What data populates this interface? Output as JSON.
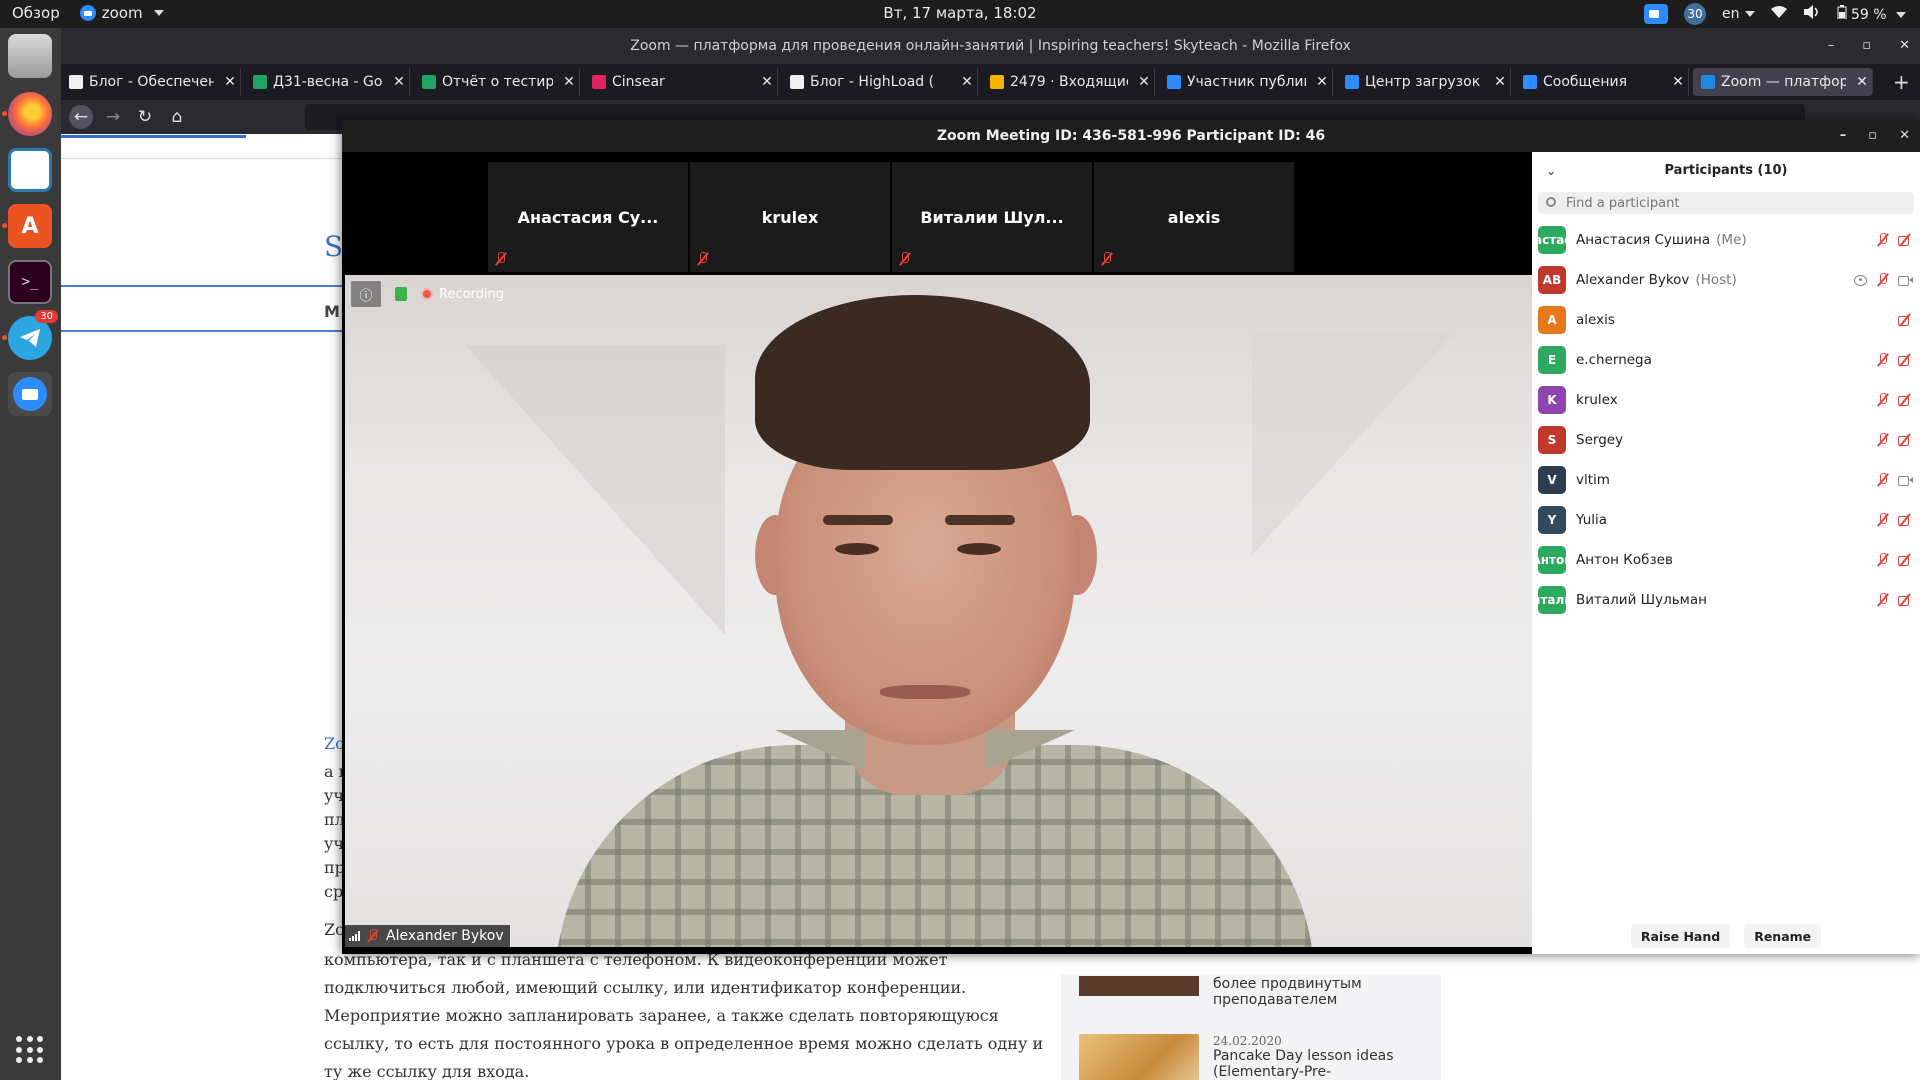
{
  "topbar": {
    "overview": "Обзор",
    "app_name": "zoom",
    "clock": "Вт, 17 марта, 18:02",
    "tray_badge": "30",
    "lang": "en",
    "battery": "59 %"
  },
  "dock": {
    "telegram_badge": "30"
  },
  "firefox": {
    "title": "Zoom — платформа для проведения онлайн-занятий | Inspiring teachers! Skyteach - Mozilla Firefox",
    "tabs": [
      {
        "label": "Блог - Обеспечен",
        "color": "#f0f0f0"
      },
      {
        "label": "Д31-весна - Goog",
        "color": "#1fa463"
      },
      {
        "label": "Отчёт о тестиров",
        "color": "#1fa463"
      },
      {
        "label": "Cinsear",
        "color": "#e0245e"
      },
      {
        "label": "Блог - HighLoad (",
        "color": "#f0f0f0"
      },
      {
        "label": "2479 · Входящие",
        "color": "#f4b400"
      },
      {
        "label": "Участник публик",
        "color": "#2d8cff"
      },
      {
        "label": "Центр загрузок -",
        "color": "#2d8cff"
      },
      {
        "label": "Сообщения",
        "color": "#2d8cff"
      },
      {
        "label": "Zoom — платфор",
        "color": "#1e88e5"
      }
    ],
    "page": {
      "heading_fragment": "S",
      "menu_fragment": "M",
      "link_fragment": "Zo",
      "zo_fragment": "Zo",
      "left_fragments": [
        "а в",
        "уч",
        "пл",
        "уч",
        "пр",
        "ср"
      ],
      "paragraph": "компьютера, так и с планшета с телефоном. К видеоконференции может подключиться любой, имеющий ссылку, или идентификатор конференции. Мероприятие можно запланировать заранее, а также сделать повторяющуюся ссылку, то есть для постоянного урока в определенное время можно сделать одну и ту же ссылку для входа.",
      "sidebar": {
        "item1_title": "более продвинутым преподавателем",
        "item2_date": "24.02.2020",
        "item2_title": "Pancake Day lesson ideas (Elementary-Pre-Intermediate)"
      }
    }
  },
  "zoom": {
    "title": "Zoom Meeting ID: 436-581-996 Participant ID: 46",
    "thumbnails": [
      {
        "name": "Анастасия Су..."
      },
      {
        "name": "krulex"
      },
      {
        "name": "Виталии Шул..."
      },
      {
        "name": "alexis"
      }
    ],
    "recording_label": "Recording",
    "speaker_name": "Alexander Bykov",
    "participants": {
      "header": "Participants (10)",
      "search_placeholder": "Find a participant",
      "list": [
        {
          "initials": "Анастасия",
          "color": "#2eaa60",
          "name": "Анастасия Сушина",
          "role": "(Me)"
        },
        {
          "initials": "AB",
          "color": "#c0392b",
          "name": "Alexander Bykov",
          "role": "(Host)"
        },
        {
          "initials": "A",
          "color": "#e6771a",
          "name": "alexis",
          "role": ""
        },
        {
          "initials": "E",
          "color": "#2eaa60",
          "name": "e.chernega",
          "role": ""
        },
        {
          "initials": "K",
          "color": "#8e44ad",
          "name": "krulex",
          "role": ""
        },
        {
          "initials": "S",
          "color": "#c0392b",
          "name": "Sergey",
          "role": ""
        },
        {
          "initials": "V",
          "color": "#2c3e50",
          "name": "vltim",
          "role": ""
        },
        {
          "initials": "Y",
          "color": "#34495e",
          "name": "Yulia",
          "role": ""
        },
        {
          "initials": "Антон",
          "color": "#2eaa60",
          "name": "Антон Кобзев",
          "role": ""
        },
        {
          "initials": "Виталий",
          "color": "#2eaa60",
          "name": "Виталий Шульман",
          "role": ""
        }
      ],
      "raise_hand": "Raise Hand",
      "rename": "Rename"
    }
  }
}
